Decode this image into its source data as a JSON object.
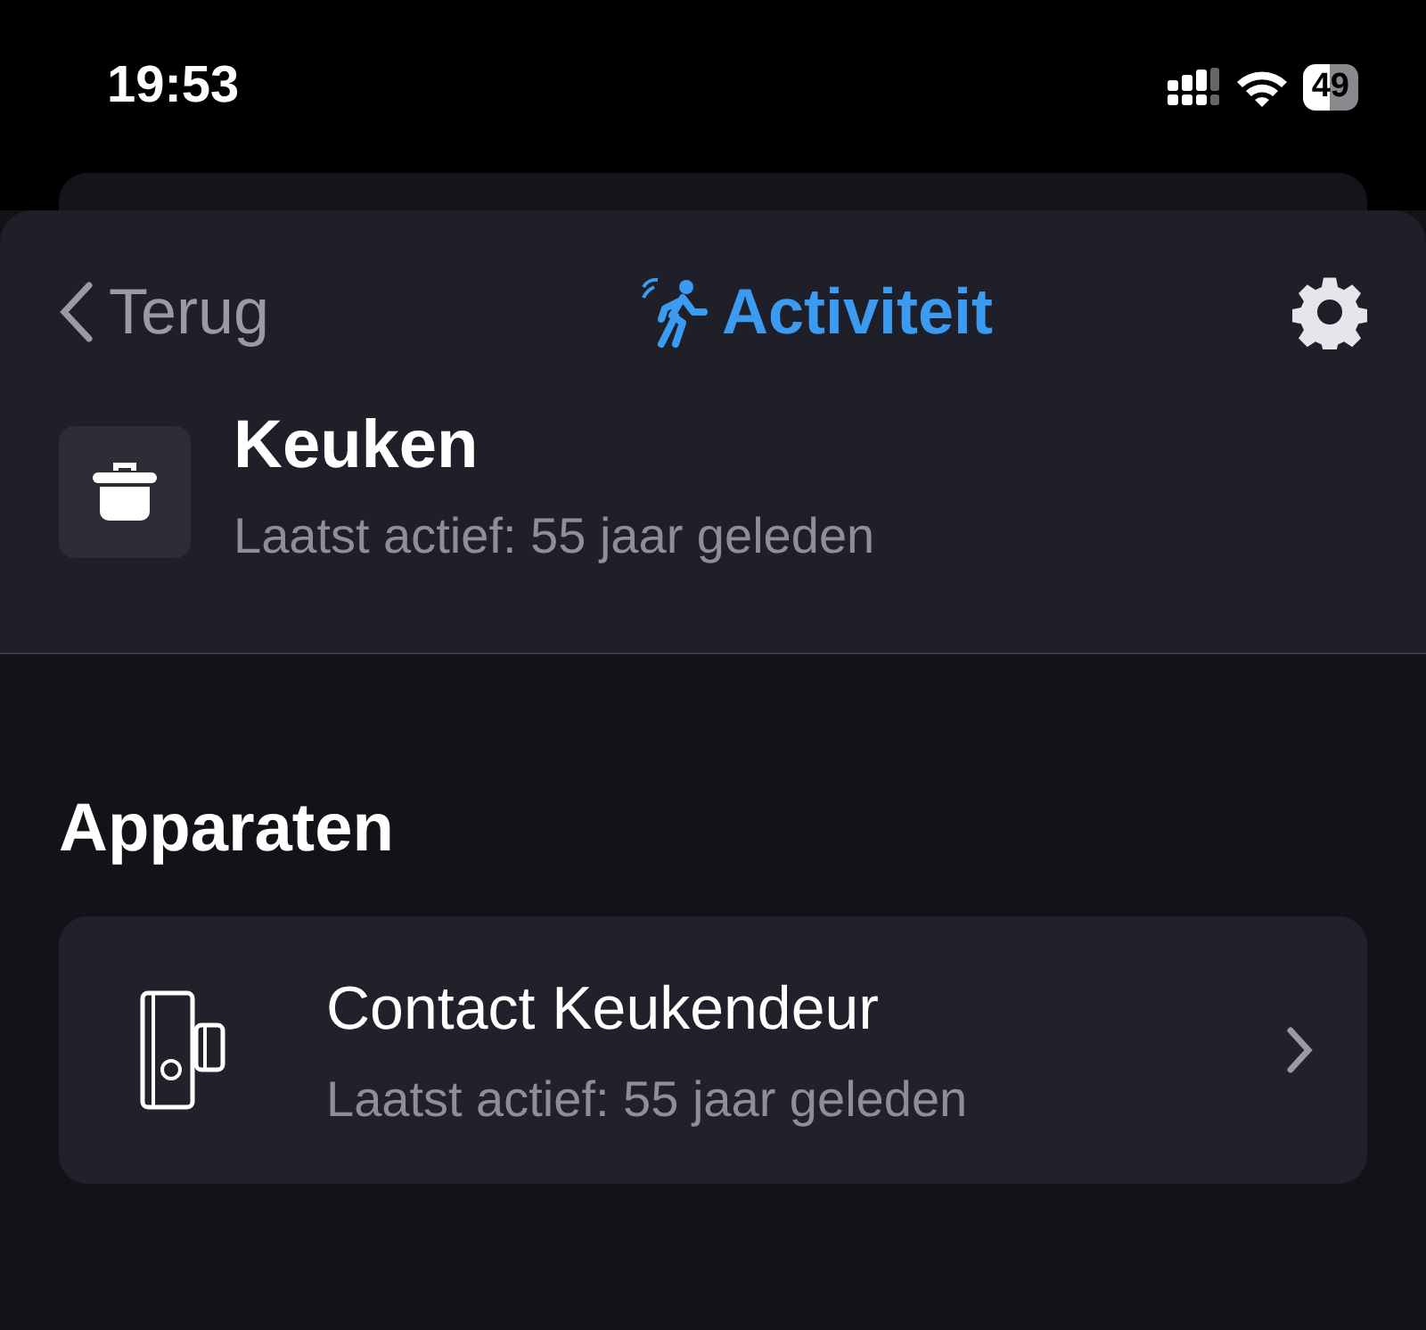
{
  "status_bar": {
    "time": "19:53",
    "battery": "49"
  },
  "header": {
    "back": "Terug",
    "title": "Activiteit"
  },
  "room": {
    "name": "Keuken",
    "subtitle": "Laatst actief: 55 jaar geleden"
  },
  "section": {
    "title": "Apparaten"
  },
  "devices": [
    {
      "name": "Contact Keukendeur",
      "subtitle": "Laatst actief: 55 jaar geleden"
    }
  ]
}
